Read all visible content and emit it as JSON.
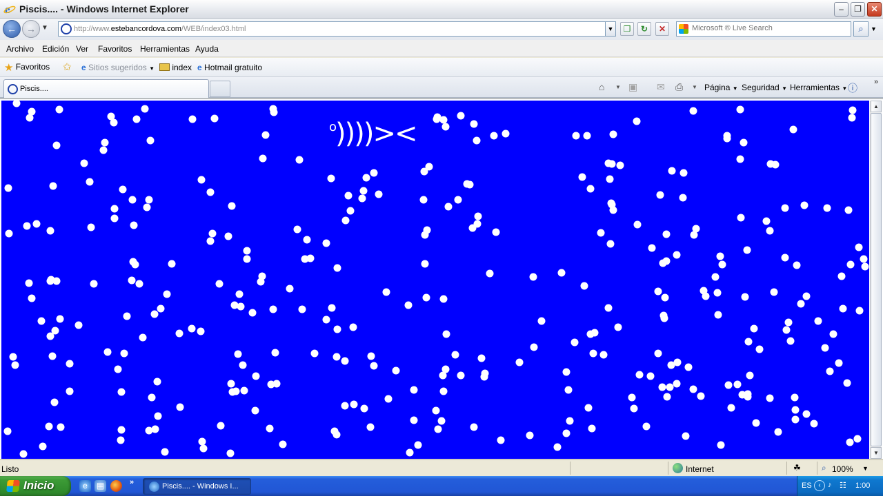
{
  "window": {
    "title": "Piscis.... - Windows Internet Explorer",
    "minimize_glyph": "–",
    "maximize_glyph": "❐",
    "close_glyph": "✕"
  },
  "address": {
    "url_prefix": "http://www.",
    "url_domain": "estebancordova.com",
    "url_suffix": "/WEB/index03.html",
    "search_placeholder": "Microsoft ® Live Search"
  },
  "menu": [
    "Archivo",
    "Edición",
    "Ver",
    "Favoritos",
    "Herramientas",
    "Ayuda"
  ],
  "favorites_bar": {
    "favorites_label": "Favoritos",
    "suggested_label": "Sitios sugeridos",
    "links": [
      "index",
      "Hotmail gratuito"
    ]
  },
  "tabs": {
    "active_title": "Piscis...."
  },
  "command_bar": {
    "page_label": "Página",
    "security_label": "Seguridad",
    "tools_label": "Herramientas"
  },
  "page": {
    "background_color": "#0000ff",
    "bubble_color": "#ffffff",
    "fish_eye": "o",
    "fish_body": "))))><"
  },
  "status": {
    "text": "Listo",
    "zone": "Internet",
    "zoom": "100%"
  },
  "taskbar": {
    "start_label": "Inicio",
    "task_label": "Piscis.... - Windows I...",
    "language": "ES",
    "clock": "1:00"
  }
}
